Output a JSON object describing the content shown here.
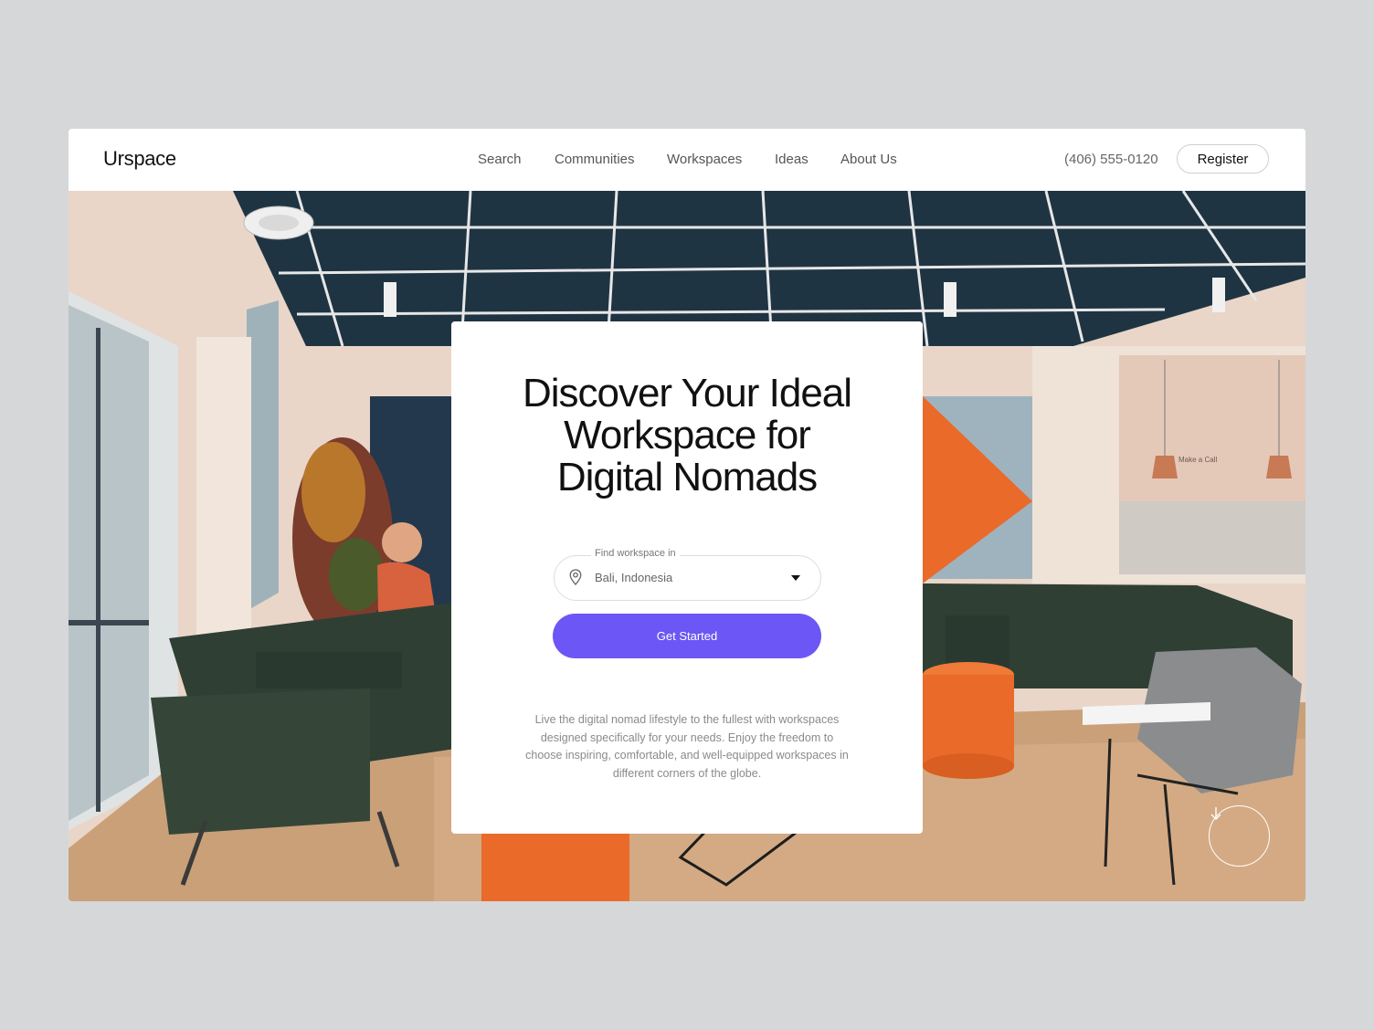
{
  "brand": {
    "name": "Urspace"
  },
  "nav": {
    "items": [
      {
        "label": "Search"
      },
      {
        "label": "Communities"
      },
      {
        "label": "Workspaces"
      },
      {
        "label": "Ideas"
      },
      {
        "label": "About Us"
      }
    ]
  },
  "header": {
    "phone": "(406) 555-0120",
    "register_label": "Register"
  },
  "hero": {
    "headline_lines": [
      "Discover Your Ideal",
      "Workspace for",
      "Digital Nomads"
    ],
    "location_select": {
      "label": "Find workspace in",
      "value": "Bali, Indonesia"
    },
    "cta_label": "Get Started",
    "description": "Live the digital nomad lifestyle to the fullest with workspaces designed specifically for your needs. Enjoy the freedom to choose inspiring, comfortable, and well-equipped workspaces in different corners of the globe.",
    "wall_sign": "Make a Call"
  },
  "colors": {
    "page_bg": "#d6d7d9",
    "accent": "#6c56f5",
    "sofa": "#2f3f34",
    "ottoman": "#ea6a2a"
  },
  "icons": {
    "location": "map-pin-icon",
    "dropdown": "caret-down-icon",
    "scroll": "arrow-down-icon"
  }
}
